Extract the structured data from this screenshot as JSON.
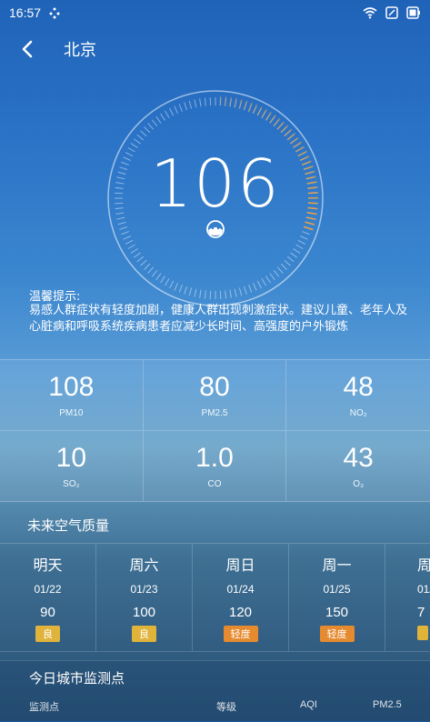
{
  "status_bar": {
    "time": "16:57"
  },
  "header": {
    "city": "北京"
  },
  "aqi": {
    "value": "106",
    "arc_fraction": 0.3
  },
  "tip": {
    "title": "温馨提示:",
    "text": "易感人群症状有轻度加剧，健康人群出现刺激症状。建议儿童、老年人及心脏病和呼吸系统疾病患者应减少长时间、高强度的户外锻炼"
  },
  "pollutants": [
    {
      "value": "108",
      "label": "PM10"
    },
    {
      "value": "80",
      "label": "PM2.5"
    },
    {
      "value": "48",
      "label": "NO₂"
    },
    {
      "value": "10",
      "label": "SO₂"
    },
    {
      "value": "1.0",
      "label": "CO"
    },
    {
      "value": "43",
      "label": "O₃"
    }
  ],
  "forecast": {
    "title": "未来空气质量",
    "days": [
      {
        "day": "明天",
        "date": "01/22",
        "aqi": "90",
        "level": "良",
        "color": "#e0b33a"
      },
      {
        "day": "周六",
        "date": "01/23",
        "aqi": "100",
        "level": "良",
        "color": "#e0b33a"
      },
      {
        "day": "周日",
        "date": "01/24",
        "aqi": "120",
        "level": "轻度",
        "color": "#e58a2e"
      },
      {
        "day": "周一",
        "date": "01/25",
        "aqi": "150",
        "level": "轻度",
        "color": "#e58a2e"
      }
    ],
    "partial": {
      "day": "周",
      "date": "01/",
      "aqi": "7"
    }
  },
  "monitor": {
    "title": "今日城市监测点",
    "columns": [
      "监测点",
      "等级",
      "AQI",
      "PM2.5"
    ]
  },
  "colors": {
    "arc": "#e8a040",
    "good": "#e0b33a",
    "light": "#e58a2e"
  }
}
